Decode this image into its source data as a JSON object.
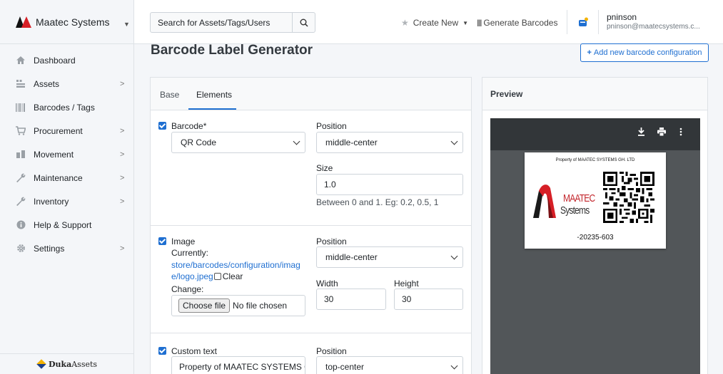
{
  "sidebar": {
    "brand": "Maatec Systems",
    "items": [
      {
        "label": "Dashboard",
        "icon": "home-icon",
        "chevron": false
      },
      {
        "label": "Assets",
        "icon": "assets-icon",
        "chevron": true
      },
      {
        "label": "Barcodes / Tags",
        "icon": "barcode-icon",
        "chevron": false
      },
      {
        "label": "Procurement",
        "icon": "cart-icon",
        "chevron": true
      },
      {
        "label": "Movement",
        "icon": "movement-icon",
        "chevron": true
      },
      {
        "label": "Maintenance",
        "icon": "wrench-icon",
        "chevron": true
      },
      {
        "label": "Inventory",
        "icon": "wrench-icon",
        "chevron": true
      },
      {
        "label": "Help & Support",
        "icon": "info-icon",
        "chevron": false
      },
      {
        "label": "Settings",
        "icon": "gear-icon",
        "chevron": true
      }
    ],
    "footer_brand_bold": "Duka",
    "footer_brand_rest": "Assets"
  },
  "topbar": {
    "search_placeholder": "Search for Assets/Tags/Users",
    "create_new": "Create New",
    "generate_barcodes": "Generate Barcodes",
    "user_name": "pninson",
    "user_email": "pninson@maatecsystems.c..."
  },
  "page": {
    "title": "Barcode Label Generator",
    "add_button": "Add new barcode configuration"
  },
  "form": {
    "tabs": [
      "Base",
      "Elements"
    ],
    "active_tab": "Elements",
    "barcode": {
      "label": "Barcode*",
      "type": "QR Code",
      "position_label": "Position",
      "position": "middle-center",
      "size_label": "Size",
      "size": "1.0",
      "size_help": "Between 0 and 1. Eg: 0.2, 0.5, 1"
    },
    "image": {
      "label": "Image",
      "currently_label": "Currently:",
      "path": "store/barcodes/configuration/image/logo.jpeg",
      "clear_label": "Clear",
      "change_label": "Change:",
      "choose_file": "Choose file",
      "no_file": "No file chosen",
      "position_label": "Position",
      "position": "middle-center",
      "width_label": "Width",
      "width": "30",
      "height_label": "Height",
      "height": "30"
    },
    "custom_text": {
      "label": "Custom text",
      "value": "Property of MAATEC SYSTEMS GH.",
      "position_label": "Position",
      "position": "top-center"
    }
  },
  "preview": {
    "title": "Preview",
    "label_header": "Property of MAATEC SYSTEMS GH. LTD",
    "logo_line1": "MAATEC",
    "logo_line2": "Systems",
    "code": "-20235-603"
  },
  "colors": {
    "accent": "#1f6fd1",
    "brand_red": "#d61f26",
    "viewer_bg": "#525659"
  }
}
